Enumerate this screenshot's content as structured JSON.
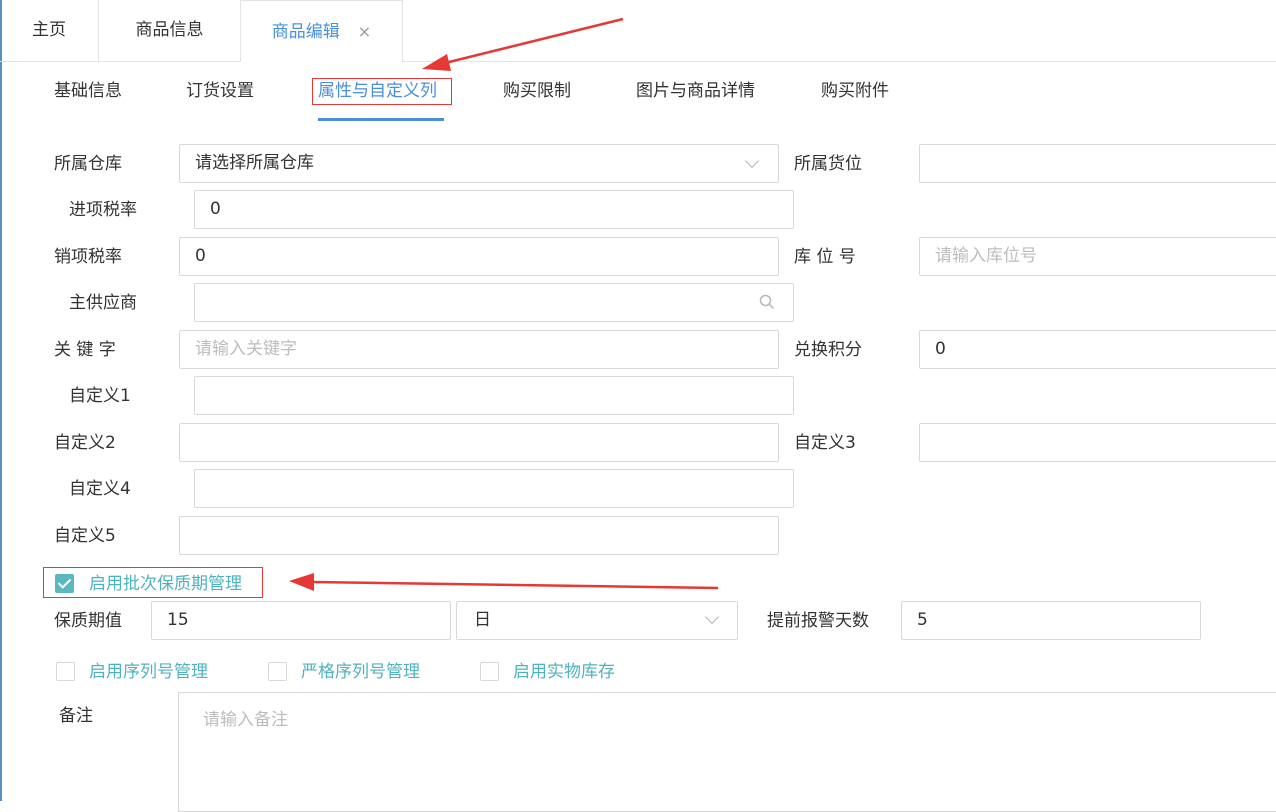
{
  "top_tabs": [
    {
      "label": "主页"
    },
    {
      "label": "商品信息"
    },
    {
      "label": "商品编辑",
      "close": "×"
    }
  ],
  "sub_tabs": [
    "基础信息",
    "订货设置",
    "属性与自定义列",
    "购买限制",
    "图片与商品详情",
    "购买附件"
  ],
  "form": {
    "warehouse": {
      "label": "所属仓库",
      "value": "请选择所属仓库"
    },
    "location": {
      "label": "所属货位",
      "value": ""
    },
    "input_tax": {
      "label": "进项税率",
      "value": "0"
    },
    "output_tax": {
      "label": "销项税率",
      "value": "0"
    },
    "bin_no": {
      "label": "库 位 号",
      "placeholder": "请输入库位号"
    },
    "supplier": {
      "label": "主供应商",
      "value": ""
    },
    "keyword": {
      "label": "关 键 字",
      "placeholder": "请输入关键字"
    },
    "points": {
      "label": "兑换积分",
      "value": "0"
    },
    "custom1": {
      "label": "自定义1",
      "value": ""
    },
    "custom2": {
      "label": "自定义2",
      "value": ""
    },
    "custom3": {
      "label": "自定义3",
      "value": ""
    },
    "custom4": {
      "label": "自定义4",
      "value": ""
    },
    "custom5": {
      "label": "自定义5",
      "value": ""
    },
    "batch_shelf_life": {
      "label": "启用批次保质期管理",
      "checked": true
    },
    "shelf_life": {
      "label": "保质期值",
      "value": "15",
      "unit": "日"
    },
    "alert_days": {
      "label": "提前报警天数",
      "value": "5"
    },
    "serial_mgmt": {
      "label": "启用序列号管理",
      "checked": false
    },
    "strict_serial": {
      "label": "严格序列号管理",
      "checked": false
    },
    "physical_stock": {
      "label": "启用实物库存",
      "checked": false
    },
    "remark": {
      "label": "备注",
      "placeholder": "请输入备注"
    }
  },
  "colors": {
    "accent": "#4a90d9",
    "checkbox": "#5bb8c0",
    "annotation": "#e53935"
  }
}
